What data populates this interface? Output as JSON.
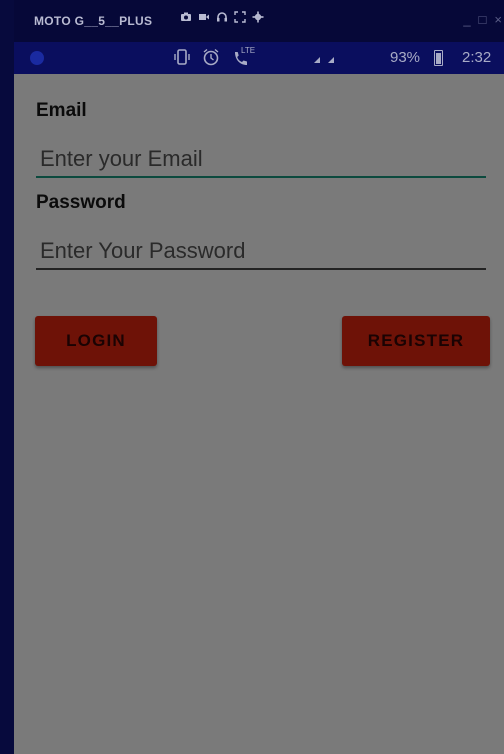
{
  "title_bar": {
    "device_name": "MOTO G__5__PLUS",
    "tool_icons": [
      "camera-icon",
      "video-icon",
      "headset-icon",
      "fullscreen-icon",
      "settings-icon"
    ],
    "window_controls": {
      "minimize": "_",
      "maximize": "□",
      "close": "×"
    }
  },
  "status_bar": {
    "icons": [
      "vibrate-icon",
      "alarm-icon",
      "lte-call-icon",
      "wifi-icon",
      "signal-icon"
    ],
    "lte_label": "LTE",
    "battery": "93%",
    "time": "2:32"
  },
  "form": {
    "email_label": "Email",
    "email_placeholder": "Enter your Email",
    "email_value": "",
    "password_label": "Password",
    "password_placeholder": "Enter Your Password",
    "password_value": ""
  },
  "buttons": {
    "login": "LOGIN",
    "register": "REGISTER"
  },
  "colors": {
    "app_background": "#7a7a7a",
    "button": "#6e1207",
    "focused_underline": "#0c4a3e",
    "status_bar": "#0a0e5e"
  }
}
